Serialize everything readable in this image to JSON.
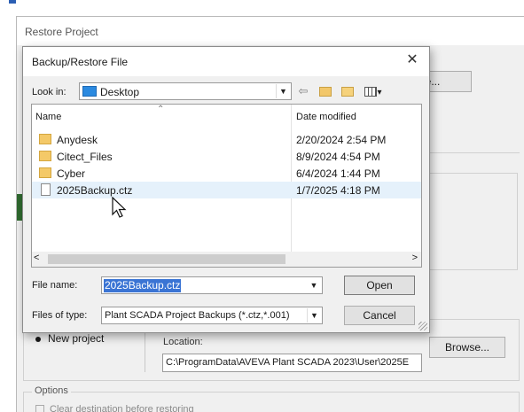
{
  "restore_window": {
    "title": "Restore Project",
    "browse_top_label": "wse...",
    "new_project_label": "New project",
    "location_label": "Location:",
    "location_value": "C:\\ProgramData\\AVEVA Plant SCADA 2023\\User\\2025E",
    "browse_bottom_label": "Browse...",
    "options_label": "Options",
    "clear_destination_label": "Clear destination before restoring"
  },
  "dialog": {
    "title": "Backup/Restore File",
    "close_glyph": "✕",
    "look_in_label": "Look in:",
    "look_in_value": "Desktop",
    "toolbar": {
      "back_glyph": "⇦",
      "view_menu_glyph": "▾"
    },
    "columns": {
      "name": "Name",
      "date_modified": "Date modified",
      "sort_glyph": "⌃"
    },
    "files": [
      {
        "name": "Anydesk",
        "date": "2/20/2024 2:54 PM",
        "icon": "folder-icon"
      },
      {
        "name": "Citect_Files",
        "date": "8/9/2024 4:54 PM",
        "icon": "folder-icon"
      },
      {
        "name": "Cyber",
        "date": "6/4/2024 1:44 PM",
        "icon": "folder-icon"
      },
      {
        "name": "2025Backup.ctz",
        "date": "1/7/2025 4:18 PM",
        "icon": "file-icon",
        "selected": true
      }
    ],
    "scroll_left_glyph": "<",
    "scroll_right_glyph": ">",
    "file_name_label": "File name:",
    "file_name_value": "2025Backup.ctz",
    "files_of_type_label": "Files of type:",
    "files_of_type_value": "Plant SCADA Project Backups (*.ctz,*.001)",
    "dropdown_glyph": "▼",
    "open_label": "Open",
    "cancel_label": "Cancel"
  }
}
